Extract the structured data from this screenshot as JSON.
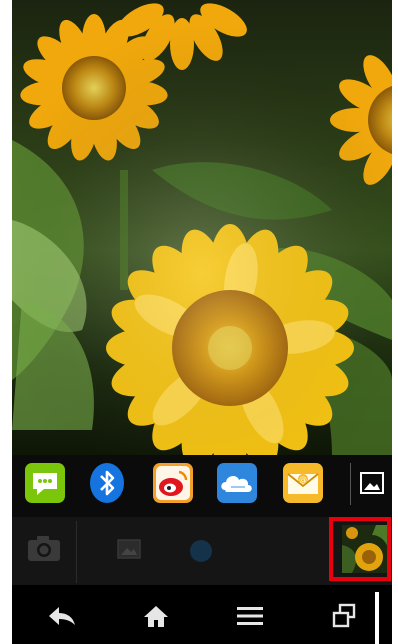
{
  "wallpaper": {
    "subject": "sunflower-field",
    "colors": {
      "petal": "#f4c20d",
      "petal_deep": "#e49a00",
      "center": "#c07a08",
      "leaf": "#3f6a22",
      "sky_dark": "#121a08"
    }
  },
  "dock": {
    "apps": [
      {
        "icon": "sms-icon",
        "color": "#7bc60a"
      },
      {
        "icon": "bluetooth-icon",
        "color": "#1674e0"
      },
      {
        "icon": "weibo-icon",
        "color": "#f2a02a"
      },
      {
        "icon": "cloud-icon",
        "color": "#2e87dc"
      },
      {
        "icon": "email-icon",
        "color": "#f5b92a"
      },
      {
        "icon": "gallery-icon",
        "color": "#ffffff"
      }
    ]
  },
  "recents": {
    "items": [
      {
        "icon": "camera-icon"
      },
      {
        "icon": "gallery-icon"
      },
      {
        "icon": "circle-app-icon"
      },
      {
        "icon": "wallpaper-thumbnail",
        "selected": true
      }
    ],
    "highlight_color": "#e8000f"
  },
  "navbar": {
    "buttons": [
      {
        "icon": "back-icon"
      },
      {
        "icon": "home-icon"
      },
      {
        "icon": "menu-icon"
      },
      {
        "icon": "recent-apps-icon"
      }
    ]
  }
}
